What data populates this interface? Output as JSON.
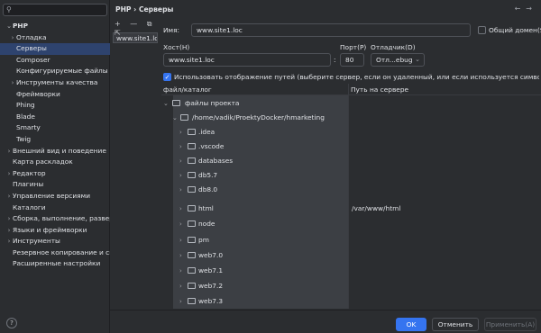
{
  "sidebar": {
    "search_icon": "search-icon",
    "items": [
      {
        "label": "PHP",
        "arrow": "⌄"
      },
      {
        "label": "Отладка",
        "arrow": "›"
      },
      {
        "label": "Серверы",
        "arrow": ""
      },
      {
        "label": "Composer",
        "arrow": ""
      },
      {
        "label": "Конфигурируемые файлы",
        "arrow": ""
      },
      {
        "label": "Инструменты качества",
        "arrow": "›"
      },
      {
        "label": "Фреймворки",
        "arrow": ""
      },
      {
        "label": "Phing",
        "arrow": ""
      },
      {
        "label": "Blade",
        "arrow": ""
      },
      {
        "label": "Smarty",
        "arrow": ""
      },
      {
        "label": "Twig",
        "arrow": ""
      },
      {
        "label": "Внешний вид и поведение",
        "arrow": "›"
      },
      {
        "label": "Карта раскладок",
        "arrow": ""
      },
      {
        "label": "Редактор",
        "arrow": "›"
      },
      {
        "label": "Плагины",
        "arrow": ""
      },
      {
        "label": "Управление версиями",
        "arrow": "›"
      },
      {
        "label": "Каталоги",
        "arrow": ""
      },
      {
        "label": "Сборка, выполнение, развертывание",
        "arrow": "›"
      },
      {
        "label": "Языки и фреймворки",
        "arrow": "›"
      },
      {
        "label": "Инструменты",
        "arrow": "›"
      },
      {
        "label": "Резервное копирование и синхронизация",
        "arrow": ""
      },
      {
        "label": "Расширенные настройки",
        "arrow": ""
      }
    ]
  },
  "header": {
    "breadcrumb_root": "PHP",
    "breadcrumb_sep": "›",
    "breadcrumb_current": "Серверы",
    "back_icon": "←",
    "forward_icon": "→"
  },
  "servers": {
    "toolbar": "+ — ⧉ ⇱",
    "items": [
      "www.site1.loc"
    ]
  },
  "form": {
    "name_label": "Имя:",
    "name_value": "www.site1.loc",
    "shared_label": "Общий домен(S)",
    "host_label": "Хост(H)",
    "host_value": "www.site1.loc",
    "port_label": "Порт(P)",
    "port_value": "80",
    "port_sep": ":",
    "debugger_label": "Отладчик(D)",
    "debugger_value": "Отл...ebug",
    "use_mappings_label": "Использовать отображение путей (выберите сервер, если он удаленный, или если используется символическая ссылка)"
  },
  "mappings": {
    "col_local": "файл/каталог",
    "col_remote": "Путь на сервере",
    "rows": [
      {
        "name": "файлы проекта",
        "remote": ""
      },
      {
        "name": "/home/vadik/ProektyDocker/hmarketing",
        "remote": ""
      },
      {
        "name": ".idea",
        "remote": ""
      },
      {
        "name": ".vscode",
        "remote": ""
      },
      {
        "name": "databases",
        "remote": ""
      },
      {
        "name": "db5.7",
        "remote": ""
      },
      {
        "name": "db8.0",
        "remote": ""
      },
      {
        "name": "html",
        "remote": "/var/www/html"
      },
      {
        "name": "node",
        "remote": ""
      },
      {
        "name": "pm",
        "remote": ""
      },
      {
        "name": "web7.0",
        "remote": ""
      },
      {
        "name": "web7.1",
        "remote": ""
      },
      {
        "name": "web7.2",
        "remote": ""
      },
      {
        "name": "web7.3",
        "remote": ""
      }
    ]
  },
  "footer": {
    "help": "?",
    "ok": "OK",
    "cancel": "Отменить",
    "apply": "Применить(A)"
  }
}
